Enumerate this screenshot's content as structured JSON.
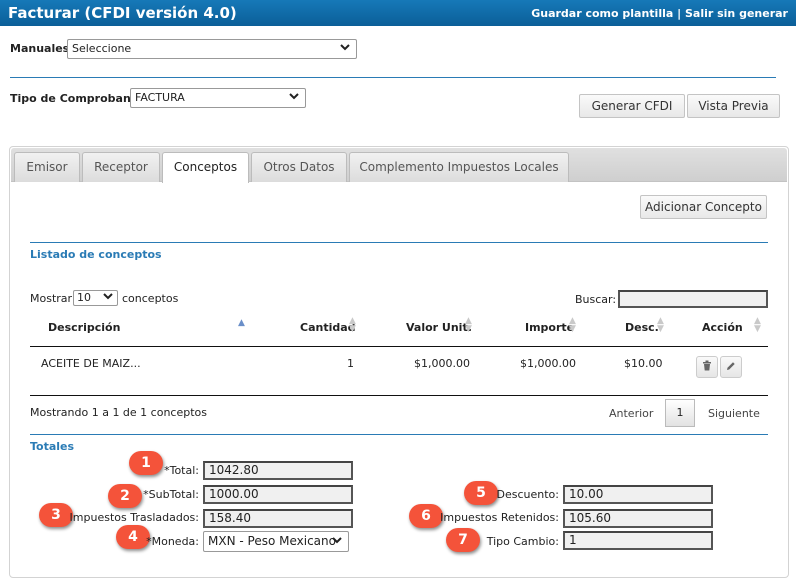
{
  "window": {
    "title": "Facturar (CFDI versión 4.0)",
    "save_template": "Guardar como plantilla",
    "separator": " | ",
    "exit": "Salir sin generar"
  },
  "manuales": {
    "label": "Manuales:",
    "value": "Seleccione"
  },
  "tipo": {
    "label": "Tipo de Comprobante:",
    "value": "FACTURA"
  },
  "buttons": {
    "generar": "Generar CFDI",
    "vista": "Vista Previa",
    "adicionar": "Adicionar Concepto"
  },
  "tabs": [
    {
      "label": "Emisor"
    },
    {
      "label": "Receptor"
    },
    {
      "label": "Conceptos"
    },
    {
      "label": "Otros Datos"
    },
    {
      "label": "Complemento Impuestos Locales"
    }
  ],
  "listado": {
    "title": "Listado de conceptos",
    "mostrar": "Mostrar",
    "page_size": "10",
    "conceptos_word": "conceptos",
    "buscar": "Buscar:",
    "columns": [
      "Descripción",
      "Cantidad",
      "Valor Unit.",
      "Importe",
      "Desc.",
      "Acción"
    ],
    "rows": [
      {
        "descripcion": "ACEITE DE MAIZ...",
        "cantidad": "1",
        "valor_unit": "$1,000.00",
        "importe": "$1,000.00",
        "desc": "$10.00"
      }
    ],
    "info": "Mostrando 1 a 1 de 1 conceptos",
    "anterior": "Anterior",
    "page": "1",
    "siguiente": "Siguiente"
  },
  "totales": {
    "title": "Totales",
    "total": {
      "label": "*Total:",
      "value": "1042.80",
      "badge": "1"
    },
    "subtotal": {
      "label": "*SubTotal:",
      "value": "1000.00",
      "badge": "2"
    },
    "trasladados": {
      "label": "Impuestos Trasladados:",
      "value": "158.40",
      "badge": "3"
    },
    "moneda": {
      "label": "*Moneda:",
      "value": "MXN - Peso Mexicano",
      "badge": "4"
    },
    "descuento": {
      "label": "Descuento:",
      "value": "10.00",
      "badge": "5"
    },
    "retenidos": {
      "label": "Impuestos Retenidos:",
      "value": "105.60",
      "badge": "6"
    },
    "tipo_cambio": {
      "label": "Tipo Cambio:",
      "value": "1",
      "badge": "7"
    }
  },
  "colors": {
    "header": "#0b5f98",
    "accent": "#2a7bb5",
    "badge": "#f4533a"
  },
  "icons": {
    "delete": "trash-icon",
    "edit": "pencil-icon",
    "dropdown": "chevron-down-icon",
    "sort": "sort-arrows-icon"
  }
}
